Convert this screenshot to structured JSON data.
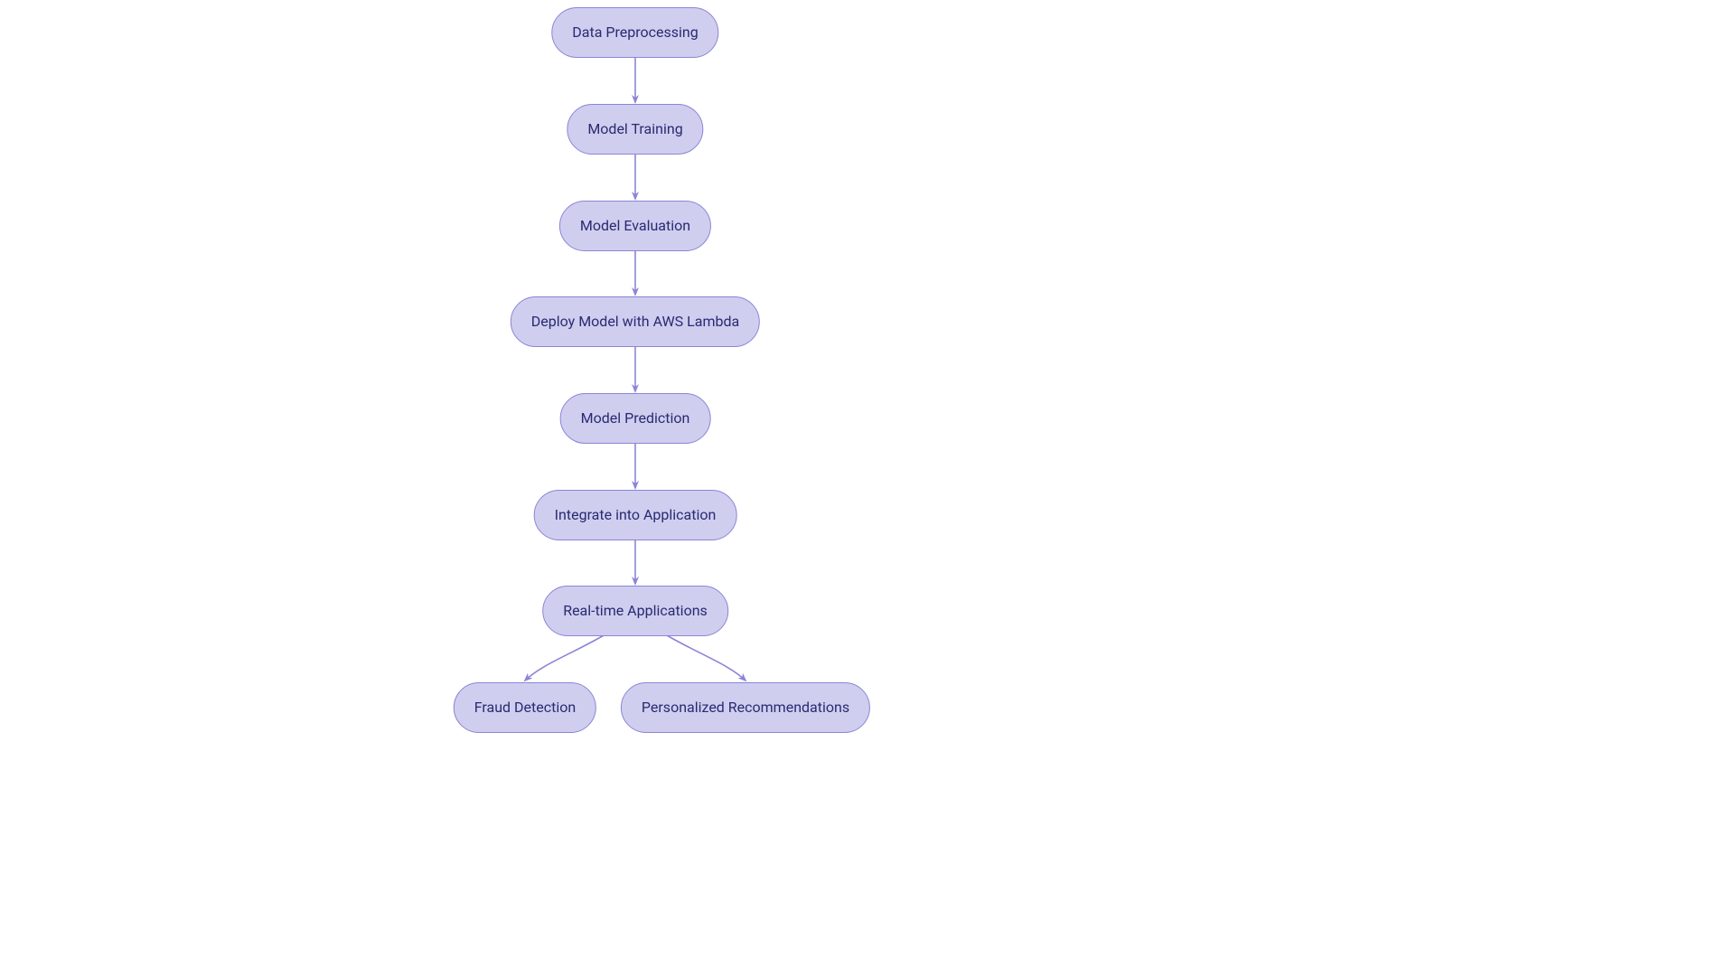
{
  "nodes": {
    "data_preprocessing": {
      "label": "Data Preprocessing"
    },
    "model_training": {
      "label": "Model Training"
    },
    "model_evaluation": {
      "label": "Model Evaluation"
    },
    "deploy_lambda": {
      "label": "Deploy Model with AWS Lambda"
    },
    "model_prediction": {
      "label": "Model Prediction"
    },
    "integrate_app": {
      "label": "Integrate into Application"
    },
    "realtime_apps": {
      "label": "Real-time Applications"
    },
    "fraud_detection": {
      "label": "Fraud Detection"
    },
    "personalized_recs": {
      "label": "Personalized Recommendations"
    }
  },
  "colors": {
    "node_fill": "#cfceef",
    "node_stroke": "#8b85d6",
    "node_text": "#2a2a72",
    "edge_stroke": "#8b85d6"
  }
}
